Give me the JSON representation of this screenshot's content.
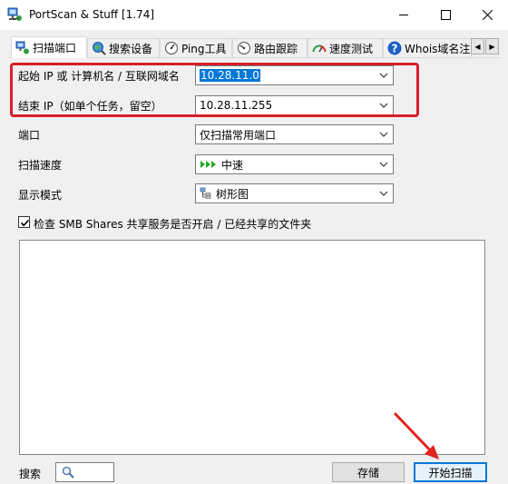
{
  "window": {
    "title": "PortScan & Stuff [1.74]"
  },
  "tabs": [
    {
      "label": "扫描端口",
      "icon": "network-scan-icon"
    },
    {
      "label": "搜索设备",
      "icon": "globe-search-icon"
    },
    {
      "label": "Ping工具",
      "icon": "ping-gauge-icon"
    },
    {
      "label": "路由跟踪",
      "icon": "trace-gauge-icon"
    },
    {
      "label": "速度测试",
      "icon": "speedometer-icon"
    },
    {
      "label": "Whois域名注",
      "icon": "help-icon"
    }
  ],
  "form": {
    "start_ip_label": "起始 IP 或 计算机名 / 互联网域名",
    "start_ip_value": "10.28.11.0",
    "end_ip_label": "结束 IP（如单个任务，留空）",
    "end_ip_value": "10.28.11.255",
    "port_label": "端口",
    "port_value": "仅扫描常用端口",
    "speed_label": "扫描速度",
    "speed_value": "中速",
    "display_label": "显示模式",
    "display_value": "树形图",
    "smb_check_label": "检查 SMB Shares 共享服务是否开启 / 已经共享的文件夹",
    "smb_checked": true
  },
  "bottom": {
    "search_label": "搜索",
    "save_label": "存储",
    "start_label": "开始扫描"
  },
  "colors": {
    "highlight": "#d71f2a",
    "selection": "#0078d7",
    "speed_green": "#22a822"
  }
}
